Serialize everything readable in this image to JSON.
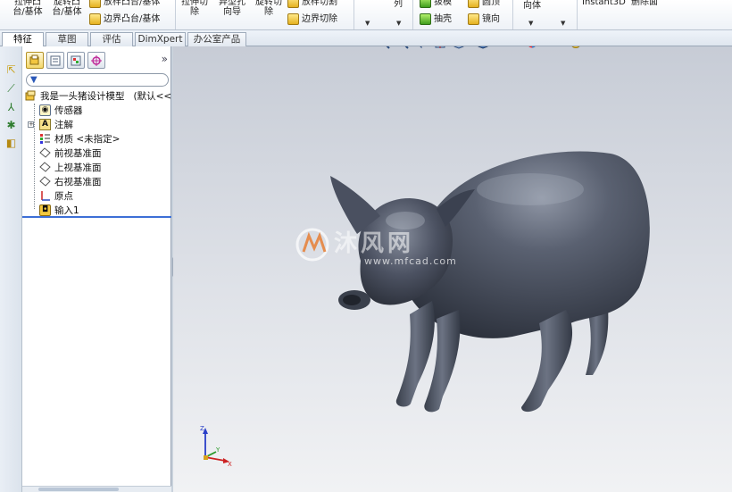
{
  "ribbon": {
    "extrude_boss": "拉伸凸\n台/基体",
    "revolve_boss": "旋转凸\n台/基体",
    "sweep_boss": "放样凸台/基体",
    "boundary_boss": "边界凸台/基体",
    "extrude_cut": "拉伸切\n除",
    "hole_wizard": "异型孔\n向导",
    "revolve_cut": "旋转切\n除",
    "loft_cut": "放样切割",
    "boundary_cut": "边界切除",
    "pattern": "列",
    "draft": "拔模",
    "shell": "抽壳",
    "dome": "圆顶",
    "mirror": "镜向",
    "geometry": "向体",
    "instant3d": "Instant3D",
    "delete_face": "删除面"
  },
  "tabs": [
    "特征",
    "草图",
    "评估",
    "DimXpert",
    "办公室产品"
  ],
  "panel": {
    "expand_arrows": "»",
    "root": "我是一头猪设计模型",
    "root_config": "(默认<<",
    "items": [
      {
        "label": "传感器",
        "icon": "sensor-icon"
      },
      {
        "label": "注解",
        "icon": "annotation-icon"
      },
      {
        "label": "材质 <未指定>",
        "icon": "material-icon"
      },
      {
        "label": "前视基准面",
        "icon": "plane-icon"
      },
      {
        "label": "上视基准面",
        "icon": "plane-icon"
      },
      {
        "label": "右视基准面",
        "icon": "plane-icon"
      },
      {
        "label": "原点",
        "icon": "origin-icon"
      },
      {
        "label": "输入1",
        "icon": "import-icon"
      }
    ]
  },
  "graphics": {
    "watermark_text": "沐风网",
    "watermark_url": "www.mfcad.com",
    "triad_labels": {
      "x": "X",
      "y": "Y",
      "z": "Z"
    }
  },
  "colors": {
    "accent_blue": "#3d6fd6",
    "viewport_top": "#c7ccd6",
    "viewport_bottom": "#f1f2f4",
    "model_shade": "#4a5160"
  }
}
